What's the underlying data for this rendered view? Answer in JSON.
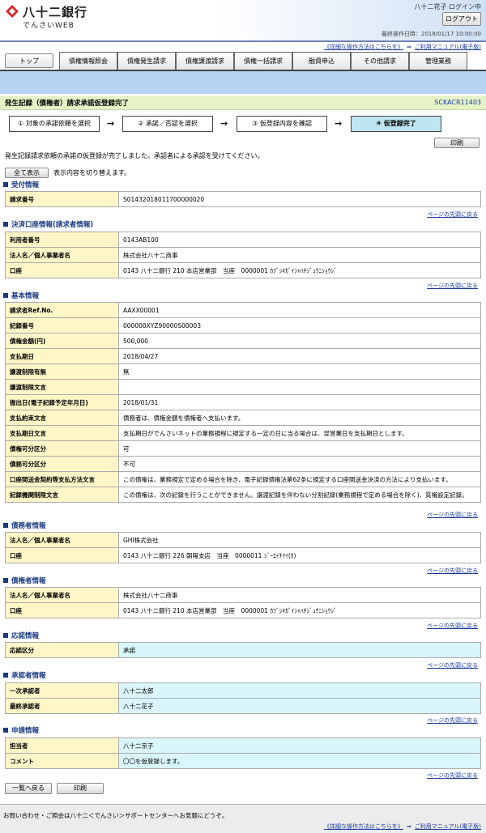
{
  "header": {
    "logo_text": "八十二銀行",
    "logo_sub": "でんさいWEB",
    "user_login": "八十二花子 ログイン中",
    "logout_label": "ログアウト",
    "last_operation": "最終操作日時：2018/01/17 10:00:00"
  },
  "help": {
    "detail": "《詳細な操作方法はこちらを》",
    "arrow": "⇒",
    "manual": "ご利用マニュアル(電子版)"
  },
  "tabs": [
    "トップ",
    "債権情報照会",
    "債権発生請求",
    "債権譲渡請求",
    "債権一括請求",
    "融資申込",
    "その他請求",
    "管理業務"
  ],
  "page": {
    "title": "発生記録（債権者）請求承諾仮登録完了",
    "screen_id": "SCKACR11403"
  },
  "steps": [
    {
      "label": "① 対象の承諾依頼を選択"
    },
    {
      "label": "② 承諾／否認を選択"
    },
    {
      "label": "③ 仮登録内容を確認"
    },
    {
      "label": "④ 仮登録完了"
    }
  ],
  "step_arrow": "→",
  "print_label": "印刷",
  "message": "発生記録請求依頼の承諾の仮登録が完了しました。承認者による承認を受けてください。",
  "show_all": {
    "button": "全て表示",
    "desc": "表示内容を切り替えます。"
  },
  "to_top": "ページの先頭に戻る",
  "sections": {
    "receipt": {
      "title": "受付情報",
      "rows": [
        [
          "請求番号",
          "S01432018011700000020"
        ]
      ]
    },
    "settlement": {
      "title": "決済口座情報(請求者情報)",
      "rows": [
        [
          "利用者番号",
          "0143AB100"
        ],
        [
          "法人名／個人事業者名",
          "株式会社八十二商事"
        ],
        [
          "口座",
          "0143 八十二銀行 210 本店営業部　当座　0000001 ｶﾌﾞｼｷｶﾞｲｼｬﾊﾁｼﾞｭｳﾆｼｮｳｼﾞ"
        ]
      ]
    },
    "basic": {
      "title": "基本情報",
      "rows": [
        [
          "請求者Ref.No.",
          "AAXX00001"
        ],
        [
          "記録番号",
          "000000XYZ90000S00003"
        ],
        [
          "債権金額(円)",
          "500,000"
        ],
        [
          "支払期日",
          "2018/04/27"
        ],
        [
          "譲渡制限有無",
          "無"
        ],
        [
          "譲渡制限文言",
          ""
        ],
        [
          "振出日(電子記録予定年月日)",
          "2018/01/31"
        ],
        [
          "支払約束文言",
          "債務者は、債権金額を債権者へ支払います。"
        ],
        [
          "支払期日文言",
          "支払期日がでんさいネットの業務規程に規定する一定の日に当る場合は、翌営業日を支払期日とします。"
        ],
        [
          "債権可分区分",
          "可"
        ],
        [
          "債務可分区分",
          "不可"
        ],
        [
          "口座間送金契約等支払方法文言",
          "この債権は、業務規定で定める場合を除き、電子記録債権法第62条に規定する口座間送金決済の方法により支払います。"
        ],
        [
          "記録機関制限文言",
          "この債権は、次の記録を行うことができません。譲渡記録を伴わない分割記録(業務規程で定める場合を除く)、質権設定記録。"
        ]
      ]
    },
    "debtor": {
      "title": "債務者情報",
      "rows": [
        [
          "法人名／個人事業者名",
          "GHI株式会社"
        ],
        [
          "口座",
          "0143 八十二銀行 226 朝陽支店　当座　0000011 ｼﾞｰｴｲﾁｱｲ(ｶ)"
        ]
      ]
    },
    "creditor": {
      "title": "債権者情報",
      "rows": [
        [
          "法人名／個人事業者名",
          "株式会社八十二商事"
        ],
        [
          "口座",
          "0143 八十二銀行 210 本店営業部　当座　0000001 ｶﾌﾞｼｷｶﾞｲｼｬﾊﾁｼﾞｭｳﾆｼｮｳｼﾞ"
        ]
      ]
    },
    "response": {
      "title": "応諾情報",
      "rows": [
        [
          "応諾区分",
          "承諾"
        ]
      ]
    },
    "approver": {
      "title": "承認者情報",
      "rows": [
        [
          "一次承認者",
          "八十二太郎"
        ],
        [
          "最終承認者",
          "八十二花子"
        ]
      ]
    },
    "application": {
      "title": "申請情報",
      "rows": [
        [
          "担当者",
          "八十二京子"
        ],
        [
          "コメント",
          "〇〇を仮登録します。"
        ]
      ]
    }
  },
  "bottom": {
    "back_label": "一覧へ戻る",
    "print_label": "印刷"
  },
  "footer": {
    "inquiry": "お問い合わせ・ご照会は八十二＜でんさい＞サポートセンターへお気軽にどうぞ。"
  },
  "colors": {
    "logo_red": "#d8282d",
    "key_bg": "#fff6c8",
    "title_bg": "#e6f3c8",
    "active_step": "#bfe6f0",
    "band": "#b6d4f3"
  }
}
